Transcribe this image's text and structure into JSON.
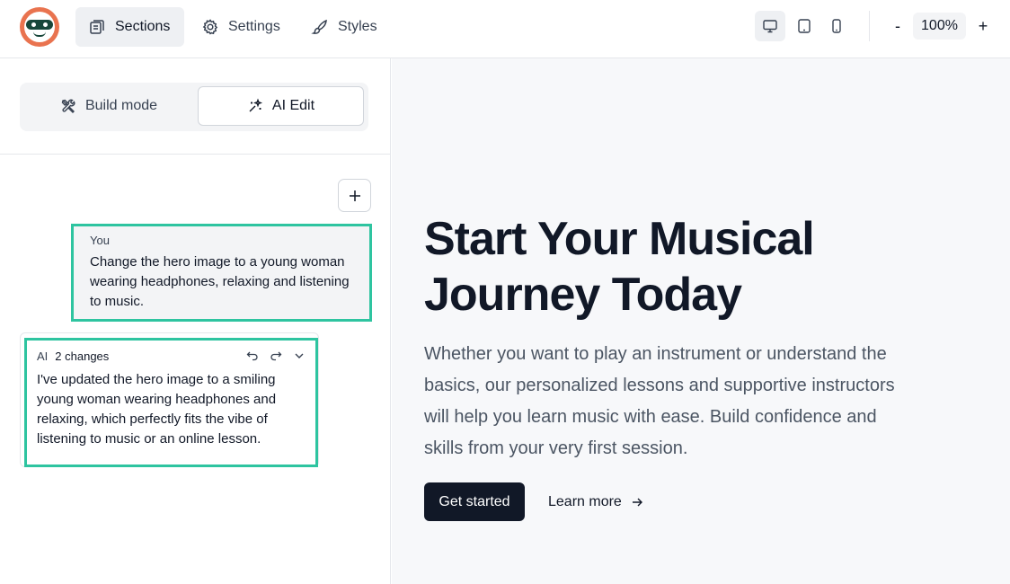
{
  "header": {
    "nav": [
      {
        "label": "Sections",
        "icon": "sections-icon",
        "active": true
      },
      {
        "label": "Settings",
        "icon": "gear-icon",
        "active": false
      },
      {
        "label": "Styles",
        "icon": "brush-icon",
        "active": false
      }
    ],
    "devices": [
      "desktop-icon",
      "tablet-icon",
      "mobile-icon"
    ],
    "zoom": {
      "minus": "-",
      "value": "100%",
      "plus": "+"
    }
  },
  "sidebar": {
    "modes": [
      {
        "label": "Build mode",
        "icon": "tools-icon",
        "active": false
      },
      {
        "label": "AI Edit",
        "icon": "sparkle-icon",
        "active": true
      }
    ],
    "add_label": "+",
    "messages": {
      "user": {
        "who": "You",
        "text": "Change the hero image to a young woman wearing headphones, relaxing and listening to music."
      },
      "ai": {
        "who": "AI",
        "badge": "2 changes",
        "text": "I've updated the hero image to a smiling young woman wearing headphones and relaxing, which perfectly fits the vibe of listening to music or an online lesson."
      }
    }
  },
  "preview": {
    "title": "Start Your Musical Journey Today",
    "subtitle": "Whether you want to play an instrument or understand the basics, our personalized lessons and supportive instructors will help you learn music with ease. Build confidence and skills from your very first session.",
    "primary_cta": "Get started",
    "secondary_cta": "Learn more"
  },
  "colors": {
    "accent_border": "#2ec4a0",
    "logo": "#e9734f",
    "dark": "#111827"
  }
}
